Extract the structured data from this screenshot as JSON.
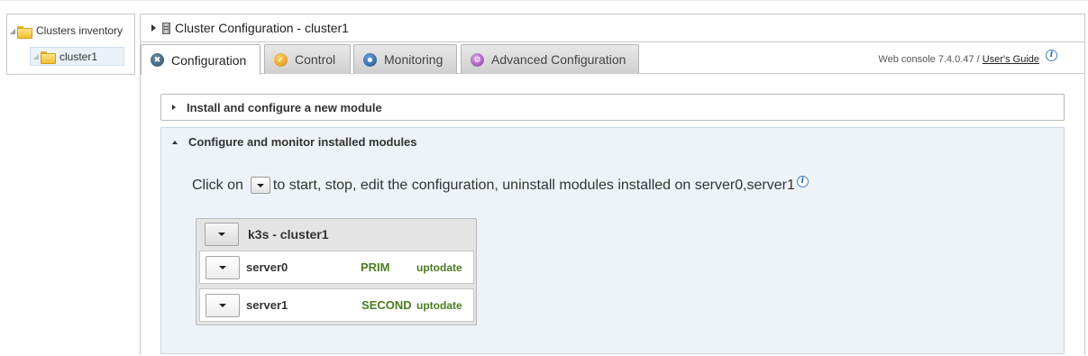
{
  "sidebar": {
    "root_label": "Clusters inventory",
    "child_label": "cluster1"
  },
  "header": {
    "title": "Cluster Configuration - cluster1"
  },
  "tabs": [
    {
      "label": "Configuration",
      "icon": "configuration-icon",
      "active": true
    },
    {
      "label": "Control",
      "icon": "control-icon",
      "active": false
    },
    {
      "label": "Monitoring",
      "icon": "monitoring-icon",
      "active": false
    },
    {
      "label": "Advanced Configuration",
      "icon": "advanced-config-icon",
      "active": false
    }
  ],
  "version": {
    "text": "Web console 7.4.0.47 / ",
    "guide_link": "User's Guide"
  },
  "sections": {
    "install": "Install and configure a new module",
    "configure": "Configure and monitor installed modules"
  },
  "instruction": {
    "prefix": "Click on",
    "suffix": "to start, stop, edit the configuration, uninstall modules installed on server0,server1"
  },
  "module": {
    "name": "k3s - cluster1",
    "servers": [
      {
        "name": "server0",
        "role": "PRIM",
        "status": "uptodate"
      },
      {
        "name": "server1",
        "role": "SECOND",
        "status": "uptodate"
      }
    ]
  },
  "colors": {
    "status_green": "#4b7c1f",
    "section_bg": "#eef3f9"
  }
}
